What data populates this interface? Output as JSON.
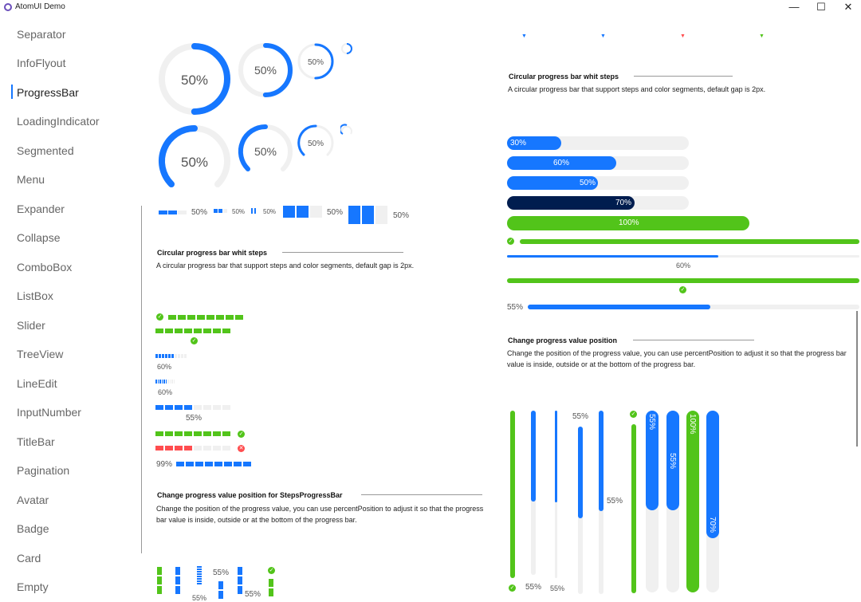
{
  "window": {
    "title": "AtomUI Demo",
    "min": "—",
    "max": "☐",
    "close": "✕"
  },
  "sidebar": {
    "selected": "ProgressBar",
    "items": [
      "Separator",
      "InfoFlyout",
      "ProgressBar",
      "LoadingIndicator",
      "Segmented",
      "Menu",
      "Expander",
      "Collapse",
      "ComboBox",
      "ListBox",
      "Slider",
      "TreeView",
      "LineEdit",
      "InputNumber",
      "TitleBar",
      "Pagination",
      "Avatar",
      "Badge",
      "Card",
      "Empty"
    ]
  },
  "colors": {
    "accent": "#1677ff",
    "success": "#52c41a",
    "error": "#ff4d4f",
    "track": "#f0f0f0",
    "dark": "#001d4f"
  },
  "circles": {
    "row1": [
      "50%",
      "50%",
      "50%"
    ],
    "row2": [
      "50%",
      "50%",
      "50%"
    ],
    "value_percent": 50
  },
  "small_steps": {
    "labels": [
      "50%",
      "50%",
      "50%",
      "50%",
      "50%"
    ]
  },
  "left_section": {
    "title": "Circular progress bar whit steps",
    "desc": "A circular progress bar that support steps and color segments, default gap is 2px.",
    "labels": {
      "l60a": "60%",
      "l60b": "60%",
      "l55": "55%",
      "l99": "99%"
    }
  },
  "left_section2": {
    "title": "Change progress value position for StepsProgressBar",
    "desc": "Change the position of the progress value, you can use percentPosition to adjust it so that the progress bar value is inside, outside or at the bottom of the progress bar.",
    "labels": {
      "a": "55%",
      "b": "55%",
      "c": "55%"
    }
  },
  "right_section": {
    "title": "Circular progress bar whit steps",
    "desc": "A circular progress bar that support steps and color segments, default gap is 2px.",
    "bars": [
      {
        "label": "30%",
        "value": 30
      },
      {
        "label": "60%",
        "value": 60
      },
      {
        "label": "50%",
        "value": 50
      },
      {
        "label": "70%",
        "value": 70
      },
      {
        "label": "100%",
        "value": 100
      }
    ],
    "line_labels": {
      "bottom60": "60%",
      "left55": "55%"
    }
  },
  "right_section2": {
    "title": "Change progress value position",
    "desc": "Change the position of the progress value, you can use percentPosition to adjust it so that the progress bar value is inside, outside or at the bottom of the progress bar.",
    "labels": {
      "b55a": "55%",
      "b55b": "55%",
      "top55": "55%",
      "mid55": "55%",
      "v55a": "55%",
      "v55b": "55%",
      "v100": "100%",
      "v70": "70%"
    }
  }
}
